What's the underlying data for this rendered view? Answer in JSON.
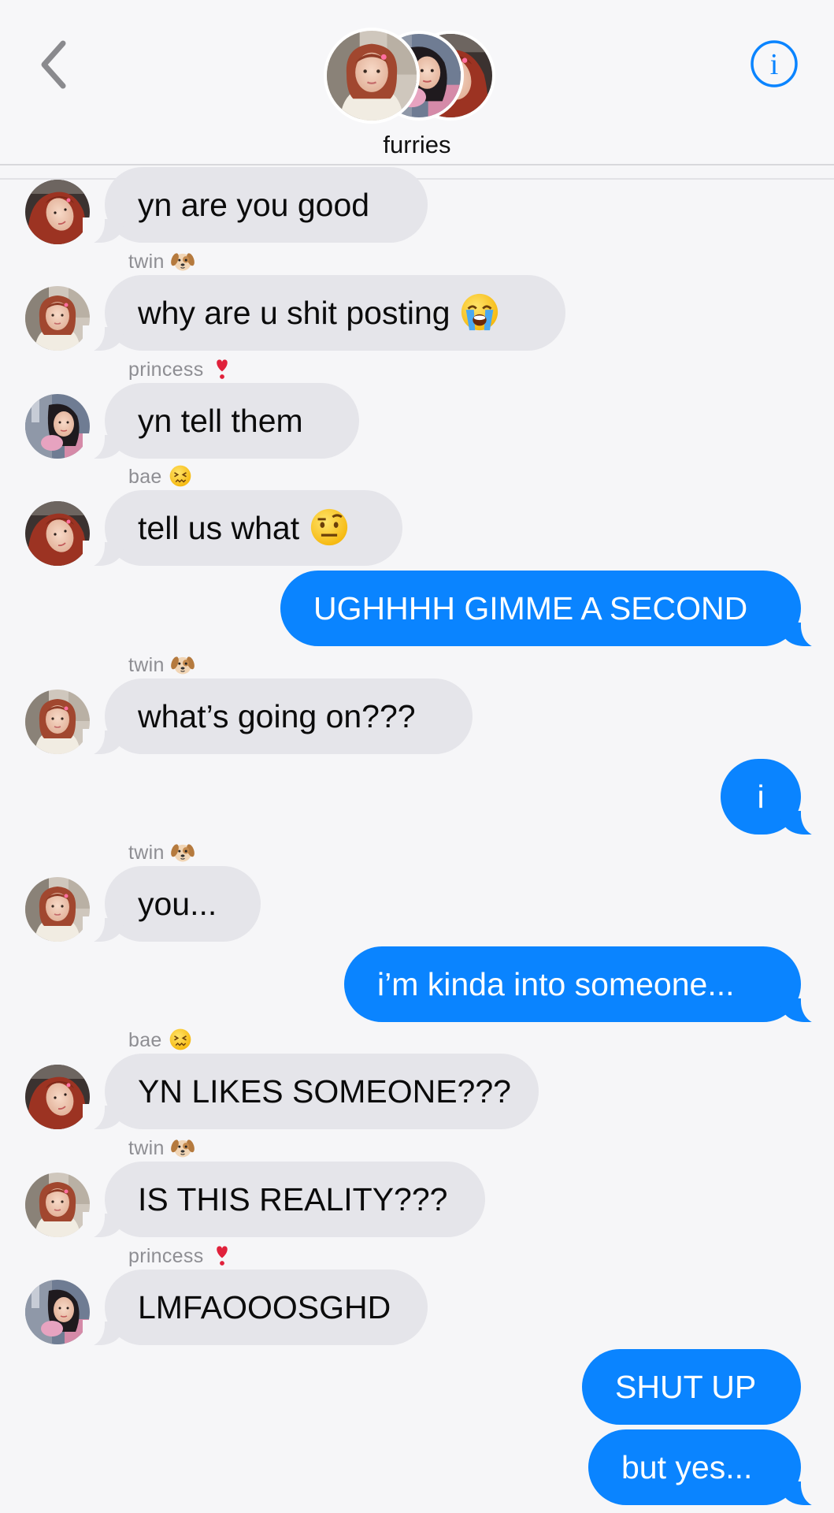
{
  "header": {
    "title": "furries",
    "back_icon": "chevron-left-icon",
    "info_icon": "info-icon",
    "info_glyph": "i"
  },
  "colors": {
    "incoming_bubble": "#e5e5ea",
    "outgoing_bubble": "#0a84ff",
    "accent": "#0a84ff",
    "sender_label": "#8e8e93"
  },
  "messages": [
    {
      "direction": "in",
      "sender": "",
      "text": "yn are you good",
      "avatar": "bae"
    },
    {
      "direction": "in",
      "sender": "twin",
      "sender_emoji": "dog-face-icon",
      "text": "why are u shit posting",
      "emoji": "loudly-crying-face-icon",
      "avatar": "twin"
    },
    {
      "direction": "in",
      "sender": "princess",
      "sender_emoji": "heart-exclamation-icon",
      "text": "yn tell them",
      "avatar": "princess"
    },
    {
      "direction": "in",
      "sender": "bae",
      "sender_emoji": "confounded-face-icon",
      "text": "tell us what",
      "emoji": "raised-eyebrow-face-icon",
      "avatar": "bae"
    },
    {
      "direction": "out",
      "text": "UGHHHH GIMME A SECOND"
    },
    {
      "direction": "in",
      "sender": "twin",
      "sender_emoji": "dog-face-icon",
      "text": "what’s going on???",
      "avatar": "twin"
    },
    {
      "direction": "out",
      "text": "i"
    },
    {
      "direction": "in",
      "sender": "twin",
      "sender_emoji": "dog-face-icon",
      "text": "you...",
      "avatar": "twin"
    },
    {
      "direction": "out",
      "text": "i’m kinda into someone..."
    },
    {
      "direction": "in",
      "sender": "bae",
      "sender_emoji": "confounded-face-icon",
      "text": "YN LIKES SOMEONE???",
      "avatar": "bae"
    },
    {
      "direction": "in",
      "sender": "twin",
      "sender_emoji": "dog-face-icon",
      "text": "IS THIS REALITY???",
      "avatar": "twin"
    },
    {
      "direction": "in",
      "sender": "princess",
      "sender_emoji": "heart-exclamation-icon",
      "text": "LMFAOOOSGHD",
      "avatar": "princess"
    },
    {
      "direction": "out",
      "text": "SHUT UP"
    },
    {
      "direction": "out",
      "text": "but yes..."
    }
  ]
}
